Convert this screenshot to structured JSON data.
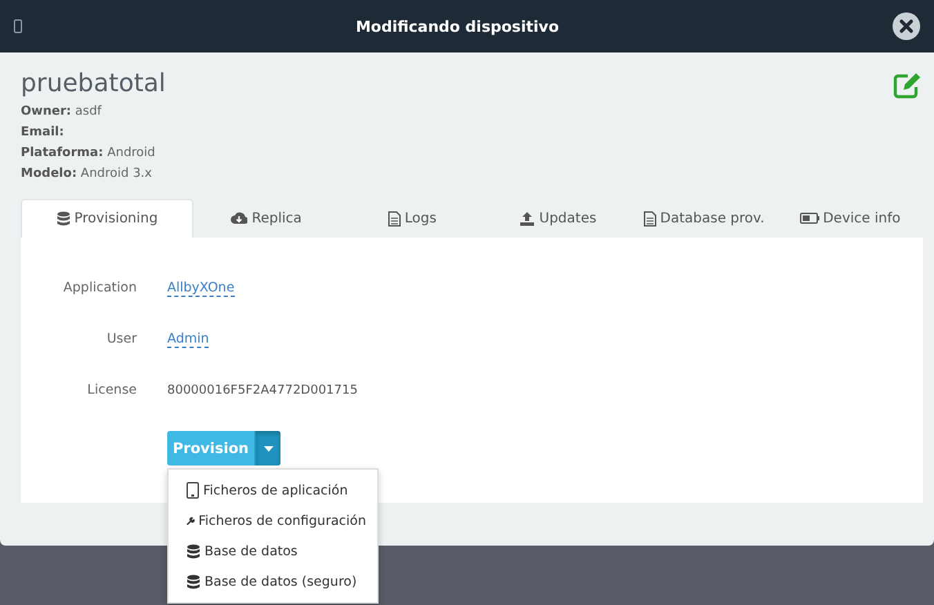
{
  "window": {
    "title": "Modificando dispositivo"
  },
  "device": {
    "name": "pruebatotal",
    "info": [
      {
        "label": "Owner:",
        "value": "asdf"
      },
      {
        "label": "Email:"
      },
      {
        "label": "Plataforma:",
        "value": "Android"
      },
      {
        "label": "Modelo:",
        "value": "Android 3.x"
      }
    ]
  },
  "tabs": [
    {
      "label": "Provisioning",
      "selected": true
    },
    {
      "label": "Replica",
      "selected": false
    },
    {
      "label": "Logs",
      "selected": false
    },
    {
      "label": "Updates",
      "selected": false
    },
    {
      "label": "Database prov.",
      "selected": false
    },
    {
      "label": "Device info",
      "selected": false
    }
  ],
  "fields": [
    {
      "label": "Application",
      "value": "AllbyXOne",
      "kind": "link"
    },
    {
      "label": "User",
      "value": "Admin",
      "kind": "link"
    },
    {
      "label": "License",
      "value": "80000016F5F2A4772D001715",
      "kind": "text"
    }
  ],
  "provision_button": {
    "label": "Provision",
    "expanded": true
  },
  "menu": [
    {
      "label": "Ficheros de aplicación"
    },
    {
      "label": "Ficheros de configuración"
    },
    {
      "label": "Base de datos"
    },
    {
      "label": "Base de datos (seguro)"
    }
  ]
}
